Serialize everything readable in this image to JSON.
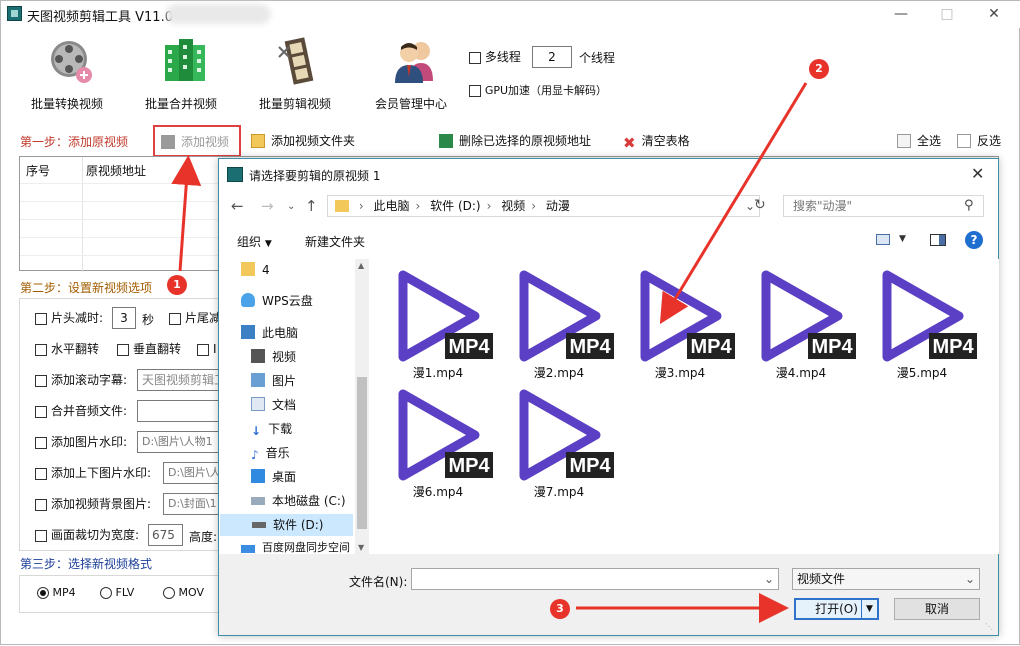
{
  "window": {
    "title": "天图视频剪辑工具 V11.0"
  },
  "toolbar": {
    "buttons": [
      {
        "label": "批量转换视频",
        "icon": "film-reel-icon"
      },
      {
        "label": "批量合并视频",
        "icon": "merge-blocks-icon"
      },
      {
        "label": "批量剪辑视频",
        "icon": "film-strip-icon"
      },
      {
        "label": "会员管理中心",
        "icon": "users-icon"
      }
    ],
    "multithread_label": "多线程",
    "thread_count": "2",
    "thread_unit": "个线程",
    "gpu_label": "GPU加速（用显卡解码）"
  },
  "step1": {
    "label": "第一步：添加原视频",
    "add_video": "添加视频",
    "add_folder": "添加视频文件夹",
    "delete_selected": "删除已选择的原视频地址",
    "clear_table": "清空表格",
    "select_all": "全选",
    "invert": "反选",
    "table_headers": [
      "序号",
      "原视频地址"
    ]
  },
  "step2": {
    "label": "第二步：设置新视频选项",
    "trim_head_label": "片头减时:",
    "trim_head_value": "3",
    "seconds_unit": "秒",
    "trim_tail_label": "片尾减",
    "hflip_label": "水平翻转",
    "vflip_label": "垂直翻转",
    "cut3_label": "I",
    "subtitle_label": "添加滚动字幕:",
    "subtitle_value": "天图视频剪辑工",
    "merge_audio_label": "合并音频文件:",
    "merge_audio_value": "",
    "image_wm_label": "添加图片水印:",
    "image_wm_value": "D:\\图片\\人物1",
    "topbottom_wm_label": "添加上下图片水印:",
    "topbottom_wm_value": "D:\\图片\\人",
    "bg_image_label": "添加视频背景图片:",
    "bg_image_value": "D:\\封面\\1",
    "crop_label": "画面裁切为宽度:",
    "crop_width": "675",
    "crop_height_label": "高度:"
  },
  "step3": {
    "label": "第三步：选择新视频格式",
    "formats": [
      "MP4",
      "FLV",
      "MOV"
    ],
    "selected_format": "MP4"
  },
  "dialog": {
    "title": "请选择要剪辑的原视频 1",
    "breadcrumb": [
      "此电脑",
      "软件 (D:)",
      "视频",
      "动漫"
    ],
    "search_placeholder": "搜索\"动漫\"",
    "organize": "组织",
    "new_folder": "新建文件夹",
    "nav_items": [
      "4",
      "WPS云盘",
      "此电脑",
      "视频",
      "图片",
      "文档",
      "下载",
      "音乐",
      "桌面",
      "本地磁盘 (C:)",
      "软件 (D:)",
      "百度网盘同步空间"
    ],
    "selected_nav": "软件 (D:)",
    "files": [
      "漫1.mp4",
      "漫2.mp4",
      "漫3.mp4",
      "漫4.mp4",
      "漫5.mp4",
      "漫6.mp4",
      "漫7.mp4"
    ],
    "file_badge": "MP4",
    "filename_label": "文件名(N):",
    "filename_value": "",
    "filetype_value": "视频文件",
    "open_button": "打开(O)",
    "cancel_button": "取消"
  },
  "annotations": [
    "1",
    "2",
    "3"
  ],
  "colors": {
    "accent_purple": "#5b3fc4",
    "annotation_red": "#e8332b",
    "dialog_border": "#3d8fa6",
    "selection_blue": "#cce8ff"
  }
}
